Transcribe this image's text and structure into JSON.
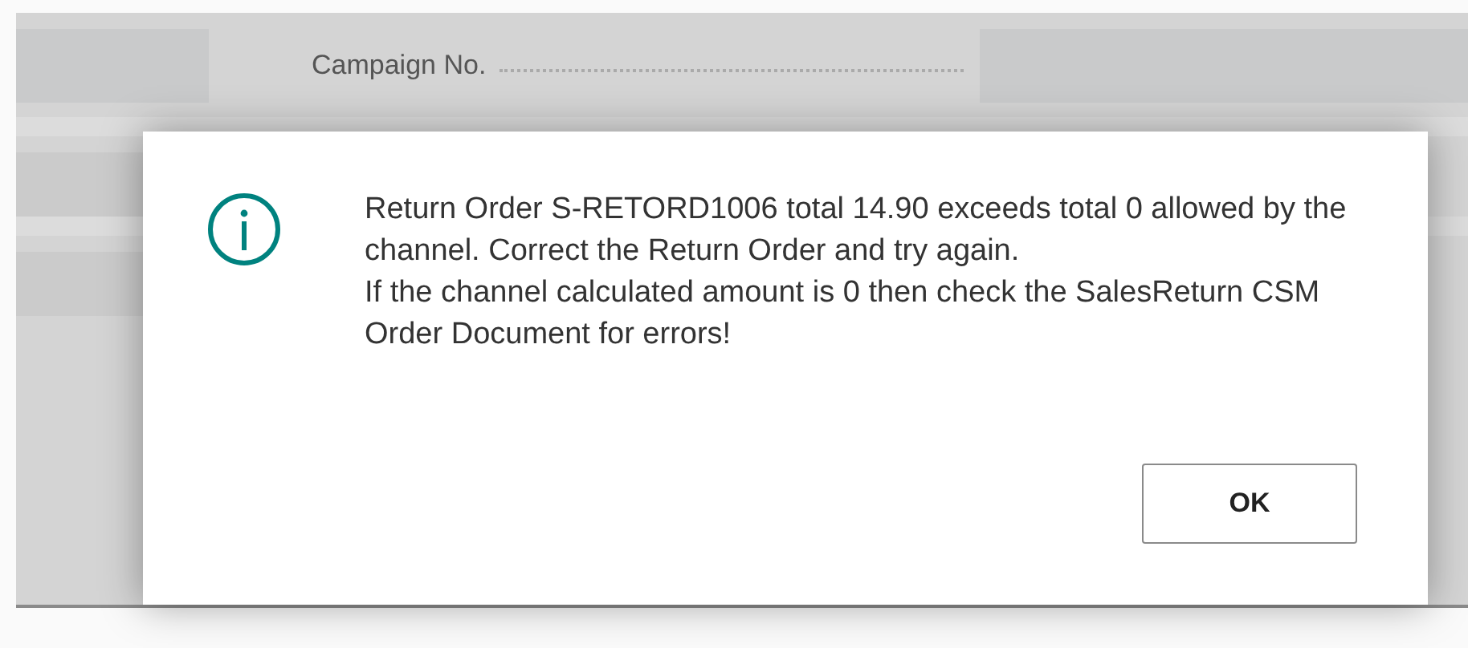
{
  "background": {
    "field_label": "Campaign No."
  },
  "dialog": {
    "kind": "info",
    "paragraphs": [
      "Return Order S-RETORD1006 total 14.90 exceeds total 0 allowed by the channel. Correct the Return Order and try again.",
      "If the channel calculated amount is 0 then check the SalesReturn CSM Order Document for errors!"
    ],
    "buttons": [
      "OK"
    ]
  }
}
